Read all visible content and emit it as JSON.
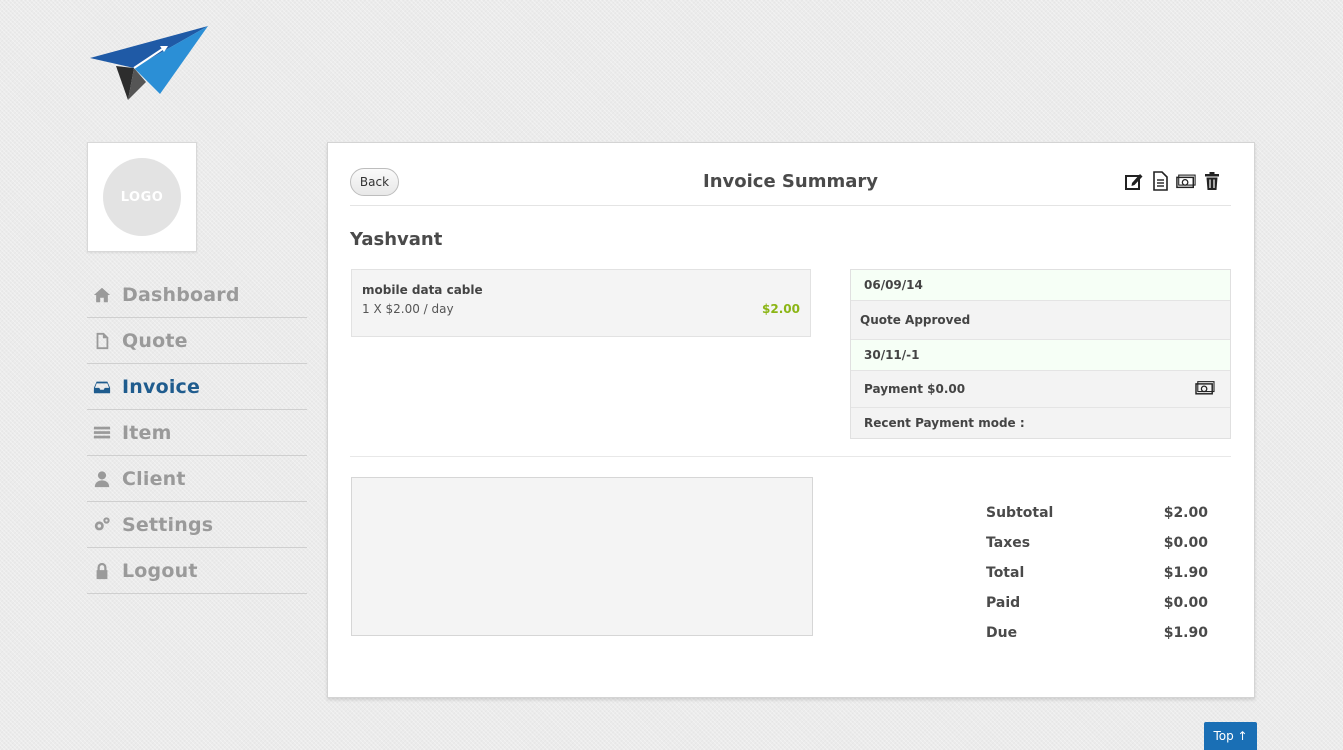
{
  "profile": {
    "logo_text": "LOGO"
  },
  "sidebar": {
    "items": [
      {
        "label": "Dashboard",
        "icon": "home-icon",
        "active": false
      },
      {
        "label": "Quote",
        "icon": "document-icon",
        "active": false
      },
      {
        "label": "Invoice",
        "icon": "inbox-icon",
        "active": true
      },
      {
        "label": "Item",
        "icon": "list-icon",
        "active": false
      },
      {
        "label": "Client",
        "icon": "user-icon",
        "active": false
      },
      {
        "label": "Settings",
        "icon": "gears-icon",
        "active": false
      },
      {
        "label": "Logout",
        "icon": "lock-icon",
        "active": false
      }
    ]
  },
  "header": {
    "back_label": "Back",
    "title": "Invoice Summary",
    "actions": [
      "edit-icon",
      "document-icon",
      "money-icon",
      "trash-icon"
    ]
  },
  "client": {
    "name": "Yashvant"
  },
  "item": {
    "name": "mobile data cable",
    "quantity_line": "1 X $2.00 / day",
    "price": "$2.00",
    "price_color": "#8bb515"
  },
  "status": {
    "date": "06/09/14",
    "state": "Quote Approved",
    "due_date": "30/11/-1",
    "payment": "Payment $0.00",
    "payment_mode": "Recent Payment mode :"
  },
  "totals": [
    {
      "label": "Subtotal",
      "value": "$2.00"
    },
    {
      "label": "Taxes",
      "value": "$0.00"
    },
    {
      "label": "Total",
      "value": "$1.90"
    },
    {
      "label": "Paid",
      "value": "$0.00"
    },
    {
      "label": "Due",
      "value": "$1.90"
    }
  ],
  "footer": {
    "top_label": "Top ↑"
  },
  "colors": {
    "accent": "#1f5c8e",
    "top_button": "#1a6fb5",
    "price": "#8bb515"
  }
}
